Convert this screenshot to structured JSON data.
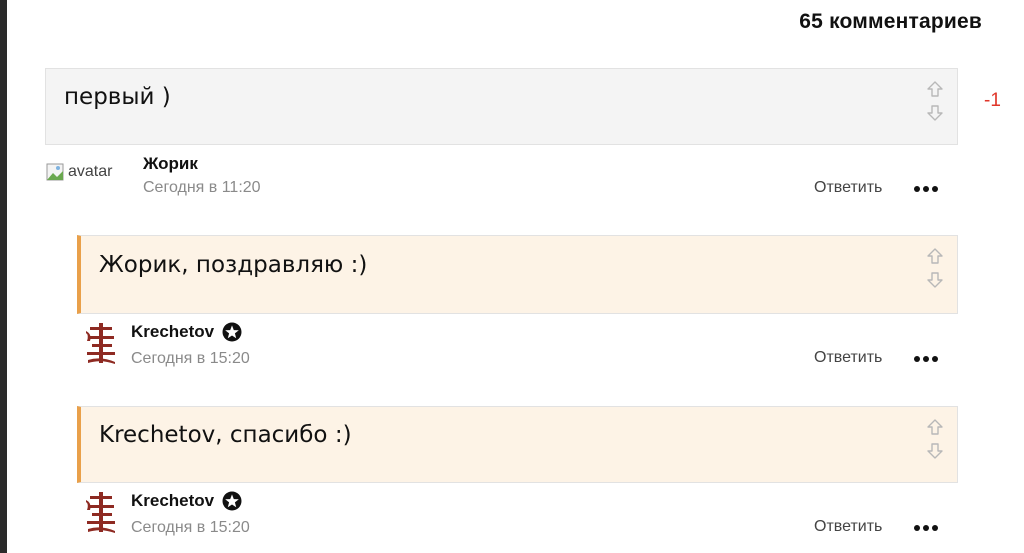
{
  "header": {
    "comment_count": "65 комментариев"
  },
  "comments": [
    {
      "text": "первый )",
      "score": "-1",
      "author": "Жорик",
      "time": "Сегодня в 11:20",
      "reply_label": "Ответить",
      "avatar_alt": "avatar",
      "avatar_icon": "broken-image-icon"
    },
    {
      "text": "Жорик, поздравляю :)",
      "author": "Krechetov",
      "time": "Сегодня в 15:20",
      "reply_label": "Ответить",
      "avatar_icon": "krechetov-logo",
      "badge_icon": "star-badge-icon"
    },
    {
      "text": "Krechetov, спасибо :)",
      "author": "Krechetov",
      "time": "Сегодня в 15:20",
      "reply_label": "Ответить",
      "avatar_icon": "krechetov-logo",
      "badge_icon": "star-badge-icon"
    }
  ],
  "icons": {
    "upvote": "arrow-up-outline-icon",
    "downvote": "arrow-down-outline-icon",
    "more": "more-dots-icon"
  },
  "colors": {
    "score_negative": "#e0362a",
    "reply_accent": "#e9a04a",
    "reply_bg": "#fdf3e6",
    "root_bg": "#f4f4f4"
  }
}
